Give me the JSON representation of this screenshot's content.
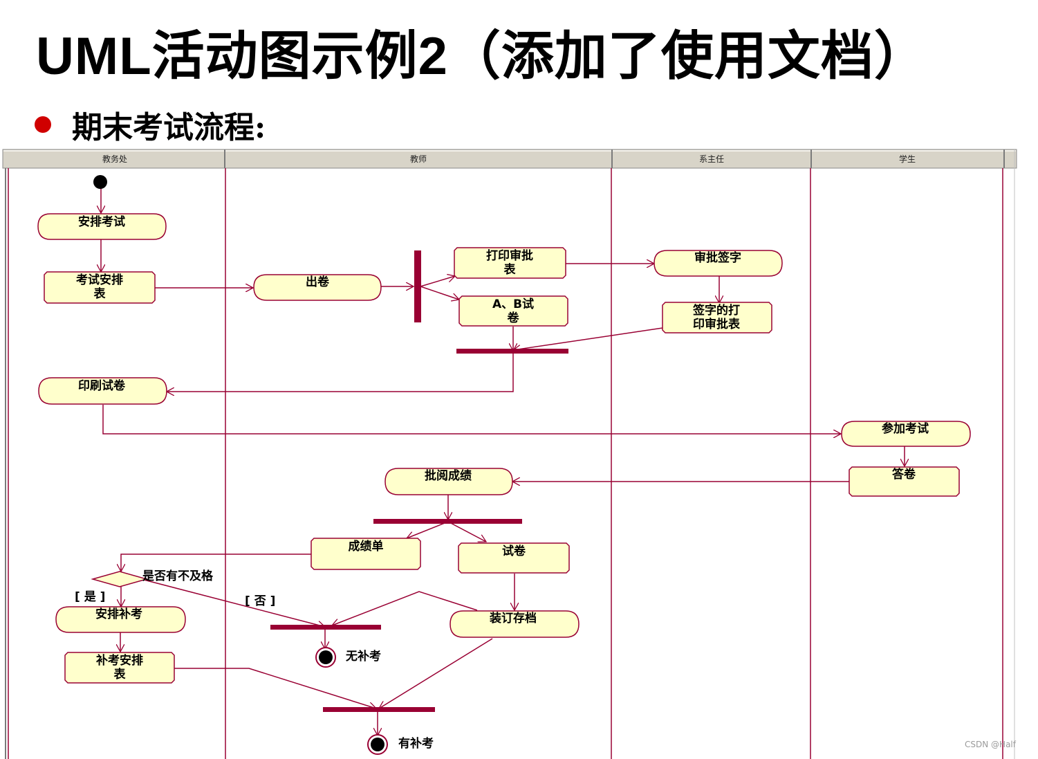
{
  "slide": {
    "title": "UML活动图示例2（添加了使用文档）",
    "bullet": "期末考试流程:"
  },
  "watermark": "CSDN @Half",
  "colors": {
    "line": "#990033",
    "node_fill": "#ffffcc",
    "header_fill": "#d8d4c8",
    "title_text": "#000000",
    "bullet_dot": "#d00000"
  },
  "swimlanes": [
    {
      "id": "lane-academic-office",
      "label": "教务处"
    },
    {
      "id": "lane-teacher",
      "label": "教师"
    },
    {
      "id": "lane-department-head",
      "label": "系主任"
    },
    {
      "id": "lane-student",
      "label": "学生"
    }
  ],
  "activities": [
    {
      "id": "arrange-exam",
      "lines": [
        "安排考试"
      ]
    },
    {
      "id": "make-paper",
      "lines": [
        "出卷"
      ]
    },
    {
      "id": "approval-sign",
      "lines": [
        "审批签字"
      ]
    },
    {
      "id": "print-papers",
      "lines": [
        "印刷试卷"
      ]
    },
    {
      "id": "take-exam",
      "lines": [
        "参加考试"
      ]
    },
    {
      "id": "grade-scores",
      "lines": [
        "批阅成绩"
      ]
    },
    {
      "id": "arrange-makeup",
      "lines": [
        "安排补考"
      ]
    },
    {
      "id": "bind-archive",
      "lines": [
        "装订存档"
      ]
    }
  ],
  "documents": [
    {
      "id": "exam-schedule",
      "lines": [
        "考试安排",
        "表"
      ]
    },
    {
      "id": "print-approval-form",
      "lines": [
        "打印审批",
        "表"
      ]
    },
    {
      "id": "ab-papers",
      "lines": [
        "A、B试",
        "卷"
      ]
    },
    {
      "id": "signed-approval-form",
      "lines": [
        "签字的打",
        "印审批表"
      ]
    },
    {
      "id": "answer-sheet",
      "lines": [
        "答卷"
      ]
    },
    {
      "id": "score-sheet",
      "lines": [
        "成绩单"
      ]
    },
    {
      "id": "exam-paper",
      "lines": [
        "试卷"
      ]
    },
    {
      "id": "makeup-schedule",
      "lines": [
        "补考安排",
        "表"
      ]
    }
  ],
  "decision": {
    "label": "是否有不及格",
    "guard_yes": "[ 是 ]",
    "guard_no": "[ 否 ]"
  },
  "finals": [
    {
      "id": "no-makeup",
      "label": "无补考"
    },
    {
      "id": "with-makeup",
      "label": "有补考"
    }
  ]
}
